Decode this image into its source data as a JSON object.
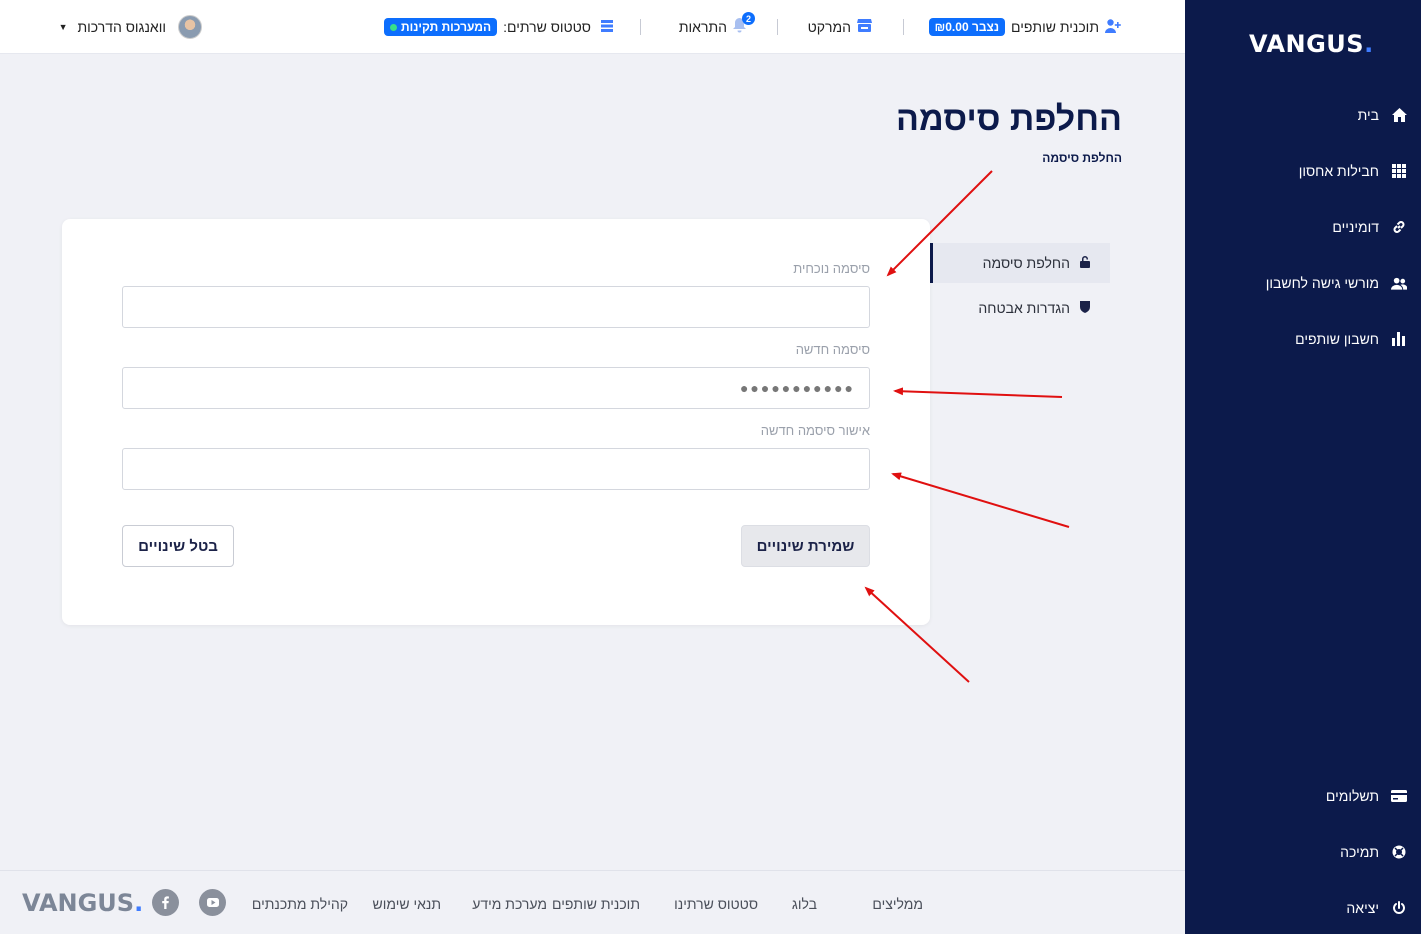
{
  "sidebar": {
    "logo": "VANGUS",
    "logo_dot": ".",
    "items": [
      {
        "label": "בית",
        "icon": "home-icon"
      },
      {
        "label": "חבילות אחסון",
        "icon": "grid-icon"
      },
      {
        "label": "דומיניים",
        "icon": "link-icon"
      },
      {
        "label": "מורשי גישה לחשבון",
        "icon": "users-icon"
      },
      {
        "label": "חשבון שותפים",
        "icon": "bar-chart-icon"
      }
    ],
    "bottom_items": [
      {
        "label": "תשלומים",
        "icon": "credit-card-icon"
      },
      {
        "label": "תמיכה",
        "icon": "lifebuoy-icon"
      },
      {
        "label": "יציאה",
        "icon": "power-icon"
      }
    ]
  },
  "topbar": {
    "affiliate_label": "תוכנית שותפים",
    "affiliate_balance": "נצבר ₪0.00",
    "market_label": "המרקט",
    "notifications_label": "התראות",
    "notifications_count": "2",
    "server_status_label": "סטטוס שרתים:",
    "server_status_value": "המערכות תקינות",
    "user_name": "וואנגוס הדרכות"
  },
  "page": {
    "title": "החלפת סיסמה",
    "breadcrumb": "החלפת סיסמה"
  },
  "settings_menu": [
    {
      "label": "החלפת סיסמה",
      "icon": "lock-icon",
      "active": true
    },
    {
      "label": "הגדרות אבטחה",
      "icon": "shield-icon",
      "active": false
    }
  ],
  "form": {
    "current_password_label": "סיסמה נוכחית",
    "current_password_value": "",
    "new_password_label": "סיסמה חדשה",
    "new_password_value": "●●●●●●●●●●●",
    "confirm_password_label": "אישור סיסמה חדשה",
    "confirm_password_value": "",
    "save_label": "שמירת שינויים",
    "cancel_label": "בטל שינויים"
  },
  "footer": {
    "links": [
      "ממליצים",
      "בלוג",
      "סטטוס שרתינו",
      "תוכנית שותפים",
      "מערכת מידע",
      "תנאי שימוש",
      "קהילת מתכנתים"
    ],
    "logo": "VANGUS",
    "logo_dot": ".",
    "social": [
      "facebook-icon",
      "youtube-icon"
    ]
  },
  "colors": {
    "sidebar_bg": "#0c1a4b",
    "accent": "#0d6efd",
    "status_ok": "#38e08a",
    "annotation_arrow": "#e01010"
  }
}
